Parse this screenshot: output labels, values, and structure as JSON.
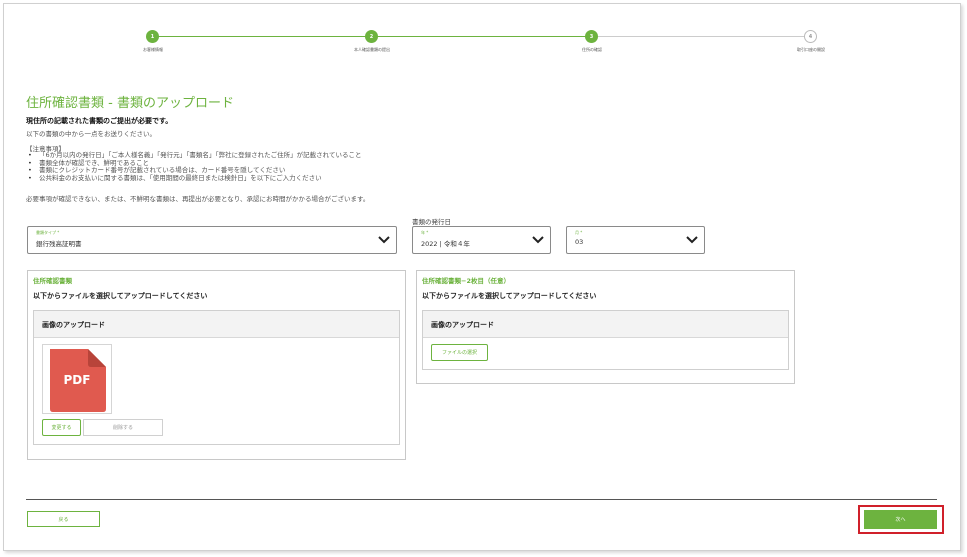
{
  "stepper": {
    "steps": [
      {
        "number": "1",
        "label": "お客様情報"
      },
      {
        "number": "2",
        "label": "本人確認書類の提出"
      },
      {
        "number": "3",
        "label": "住所の確認"
      },
      {
        "number": "4",
        "label": "取引口座の開設"
      }
    ],
    "colors": {
      "done": "#6db33f",
      "pending": "#cccccc"
    }
  },
  "header": {
    "title": "住所確認書類 - 書類のアップロード",
    "subtitle": "現住所の記載された書類のご提出が必要です。",
    "intro": "以下の書類の中から一点をお送りください。"
  },
  "notes": {
    "heading": "【注意事項】",
    "items": [
      "「6か月以内の発行日」「ご本人様名義」「発行元」「書類名」「弊社に登録されたご住所」が記載されていること",
      "書類全体が確認でき、鮮明であること",
      "書類にクレジットカード番号が記載されている場合は、カード番号を隠してください",
      "公共料金のお支払いに関する書類は、「使用期間の最終日または検針日」を以下にご入力ください"
    ],
    "warning": "必要事項が確認できない、または、不鮮明な書類は、再提出が必要となり、承認にお時間がかかる場合がございます。"
  },
  "form": {
    "date_label": "書類の発行日",
    "doc_type": {
      "caption": "書類タイプ *",
      "value": "銀行残高証明書"
    },
    "year": {
      "caption": "年 *",
      "value": "2022 | 令和４年"
    },
    "month": {
      "caption": "月 *",
      "value": "03"
    }
  },
  "panel1": {
    "title": "住所確認書類",
    "instruction": "以下からファイルを選択してアップロードしてください",
    "upload_heading": "画像のアップロード",
    "file_label": "PDF",
    "change_label": "変更する",
    "delete_label": "削除する"
  },
  "panel2": {
    "title": "住所確認書類−2枚目（任意）",
    "instruction": "以下からファイルを選択してアップロードしてください",
    "upload_heading": "画像のアップロード",
    "select_file_label": "ファイルの選択"
  },
  "footer": {
    "back_label": "戻る",
    "next_label": "次へ"
  },
  "colors": {
    "accent": "#6db33f",
    "pdf": "#e05a4f",
    "highlight": "#d0202a"
  }
}
